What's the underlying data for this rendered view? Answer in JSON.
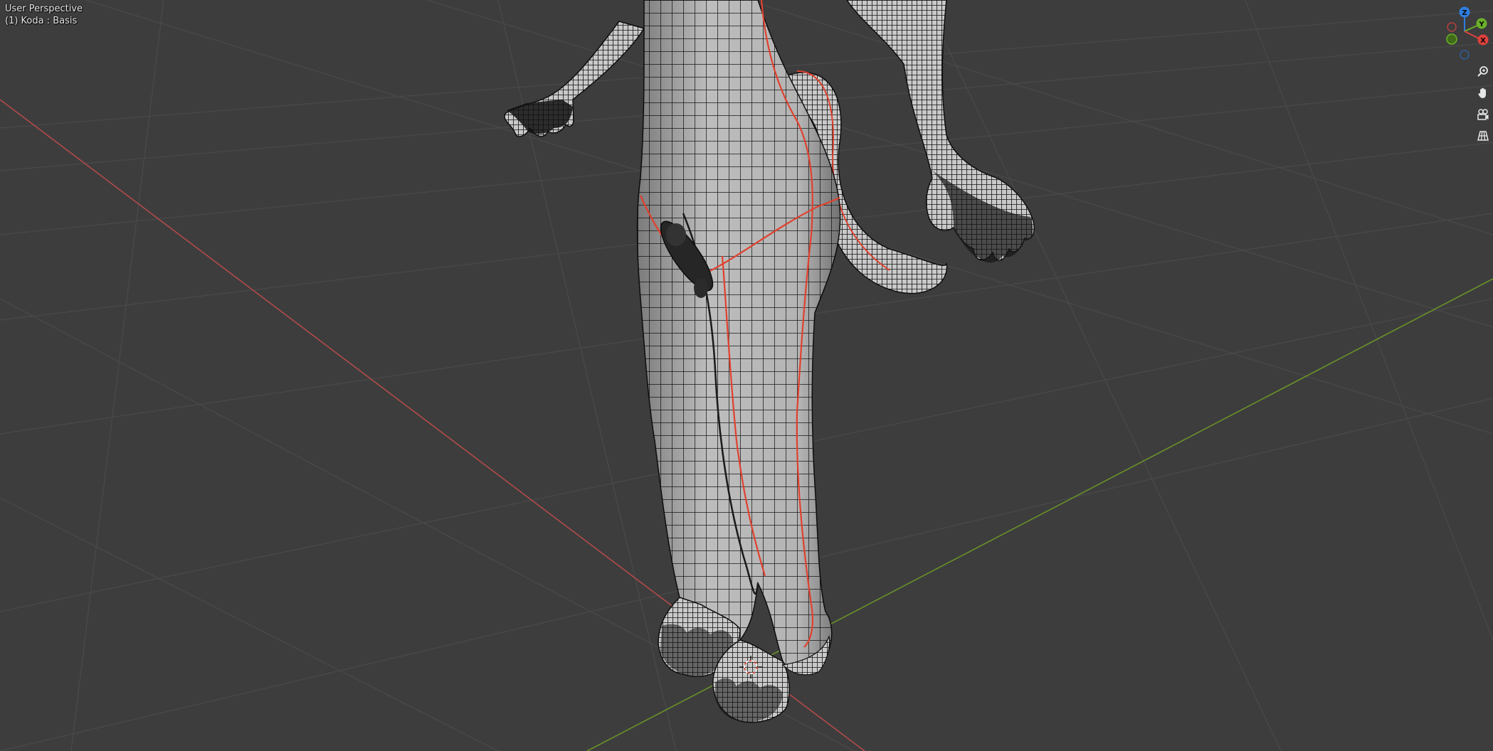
{
  "viewport": {
    "view_name": "User Perspective",
    "object_info": "(1) Koda : Basis",
    "background_color": "#3d3d3d",
    "grid_color": "#4a4a4a",
    "x_axis_color": "#c04a4a",
    "y_axis_color": "#6f9a2a",
    "seam_color": "#e0412f"
  },
  "gizmo": {
    "z_label": "Z",
    "y_label": "Y",
    "x_label": "X",
    "z_color": "#2f7fe0",
    "y_color": "#6bb02a",
    "x_color": "#e0413c"
  },
  "nav_buttons": [
    {
      "icon": "zoom-icon"
    },
    {
      "icon": "hand-pan-icon"
    },
    {
      "icon": "camera-icon"
    },
    {
      "icon": "orthographic-grid-icon"
    }
  ]
}
